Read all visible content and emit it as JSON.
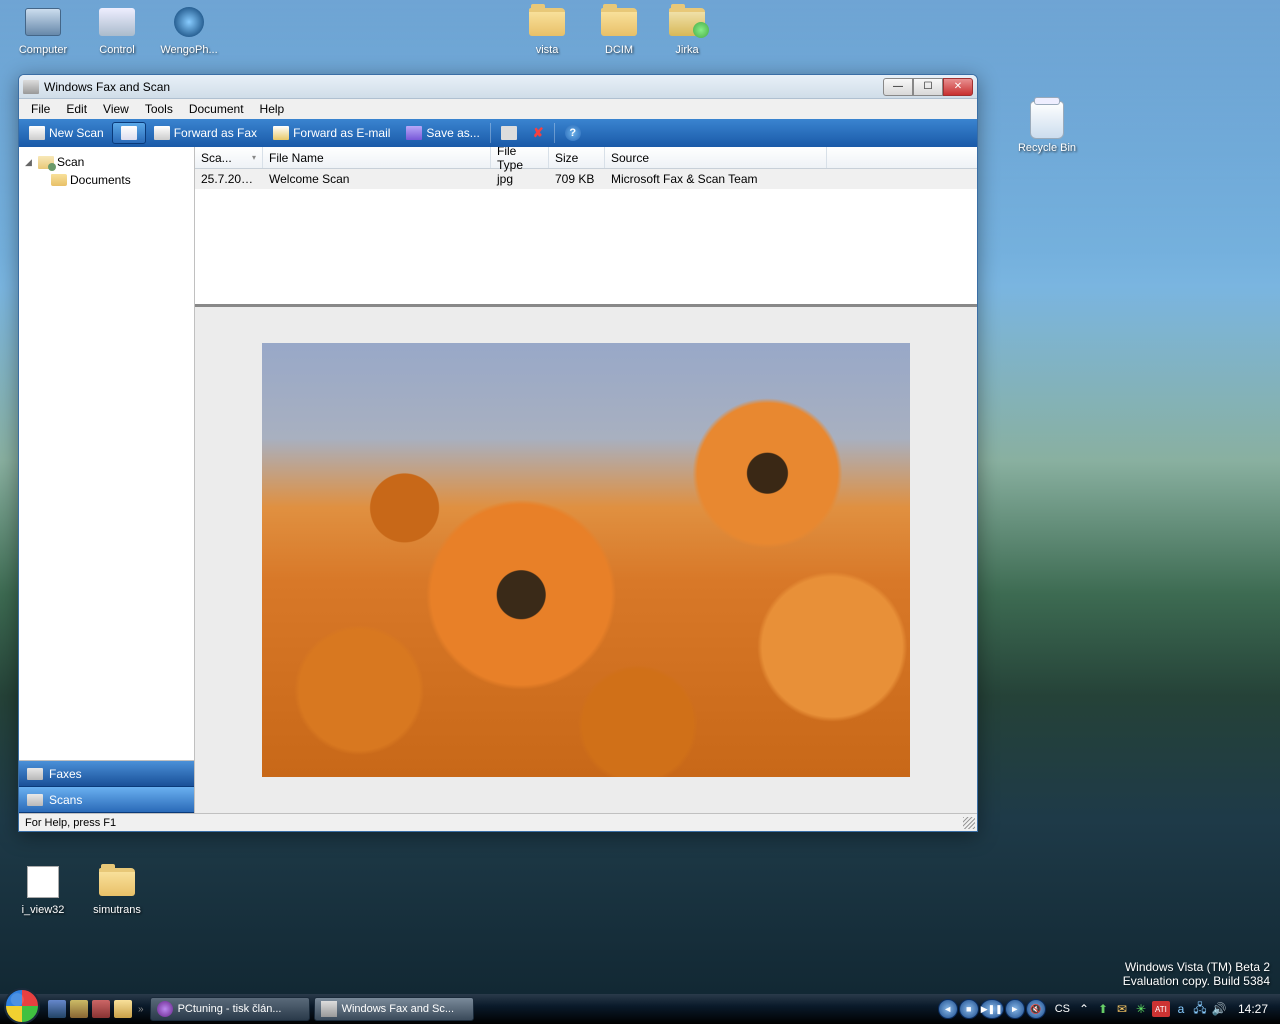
{
  "desktop": {
    "icons_top": [
      {
        "name": "computer",
        "label": "Computer"
      },
      {
        "name": "control",
        "label": "Control"
      },
      {
        "name": "wengo",
        "label": "WengoPh..."
      },
      {
        "name": "vista",
        "label": "vista",
        "folder": true
      },
      {
        "name": "dcim",
        "label": "DCIM",
        "folder": true
      },
      {
        "name": "jirka",
        "label": "Jirka",
        "folder": true
      }
    ],
    "recycle": "Recycle Bin",
    "icons_bottom": [
      {
        "name": "iview",
        "label": "i_view32"
      },
      {
        "name": "simutrans",
        "label": "simutrans",
        "folder": true
      }
    ]
  },
  "window": {
    "title": "Windows Fax and Scan",
    "menu": [
      "File",
      "Edit",
      "View",
      "Tools",
      "Document",
      "Help"
    ],
    "toolbar": {
      "new_scan": "New Scan",
      "forward_fax": "Forward as Fax",
      "forward_email": "Forward as E-mail",
      "save_as": "Save as..."
    },
    "tree": {
      "root": "Scan",
      "child": "Documents"
    },
    "nav": {
      "faxes": "Faxes",
      "scans": "Scans"
    },
    "columns": {
      "date": "Sca...",
      "name": "File Name",
      "type": "File Type",
      "size": "Size",
      "source": "Source"
    },
    "row": {
      "date": "25.7.2006 ...",
      "name": "Welcome Scan",
      "type": "jpg",
      "size": "709 KB",
      "source": "Microsoft Fax & Scan Team"
    },
    "status": "For Help, press F1"
  },
  "watermark": {
    "line1": "Windows Vista (TM) Beta 2",
    "line2": "Evaluation copy. Build 5384"
  },
  "taskbar": {
    "tasks": [
      {
        "name": "pctuning",
        "label": "PCtuning - tisk člán..."
      },
      {
        "name": "faxscan",
        "label": "Windows Fax and Sc...",
        "active": true
      }
    ],
    "lang": "CS",
    "clock": "14:27"
  }
}
